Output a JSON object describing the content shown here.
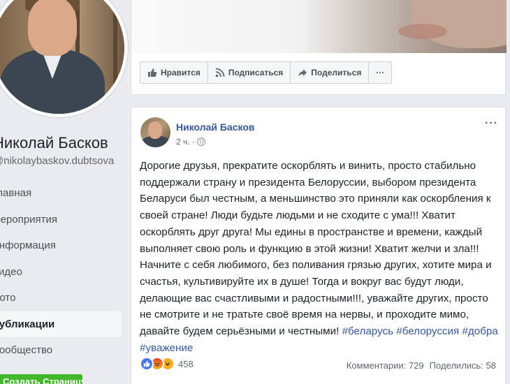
{
  "profile": {
    "name": "Николай Басков",
    "handle": "@nikolaybaskov.dubtsova"
  },
  "nav": {
    "items": [
      {
        "label": "Главная",
        "active": false
      },
      {
        "label": "Мероприятия",
        "active": false
      },
      {
        "label": "Информация",
        "active": false
      },
      {
        "label": "Видео",
        "active": false
      },
      {
        "label": "Фото",
        "active": false
      },
      {
        "label": "Публикации",
        "active": true
      },
      {
        "label": "Сообщество",
        "active": false
      }
    ],
    "create_page_label": "Создать Страницу"
  },
  "actions": {
    "like_label": "Нравится",
    "subscribe_label": "Подписаться",
    "share_label": "Поделиться",
    "more_label": "···"
  },
  "post": {
    "author": "Николай Басков",
    "time": "2 ч.",
    "more": "···",
    "text": "Дорогие друзья, прекратите оскорблять и винить, просто стабильно поддержали страну и президента Белоруссии, выбором президента Беларуси был честным, а меньшинство это приняли как оскорбления к своей стране! Люди будьте людьми и не сходите с ума!!! Хватит оскорблять друг друга! Мы едины в пространстве и времени, каждый выполняет свою роль и функцию в этой жизни! Хватит желчи и зла!!! Начните с себя любимого, без поливания грязью других, хотите мира и счастья, культивируйте их в душе! Тогда и вокруг вас будут люди, делающие вас счастливыми и радостными!!!, уважайте других, просто не смотрите и не тратьте своё время на нервы, и проходите мимо, давайте будем серьёзными и честными!",
    "hashtags": [
      "#беларусь",
      "#белоруссия",
      "#добра",
      "#уважение"
    ],
    "reactions_count": "458",
    "comments": "Комментарии: 729",
    "shares": "Поделились: 58"
  }
}
